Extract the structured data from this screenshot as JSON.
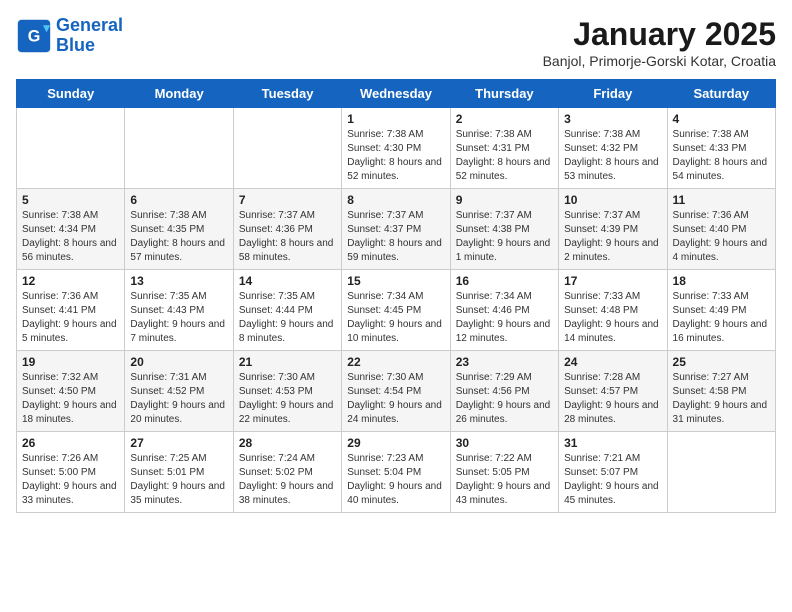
{
  "logo": {
    "line1": "General",
    "line2": "Blue"
  },
  "title": "January 2025",
  "location": "Banjol, Primorje-Gorski Kotar, Croatia",
  "days_of_week": [
    "Sunday",
    "Monday",
    "Tuesday",
    "Wednesday",
    "Thursday",
    "Friday",
    "Saturday"
  ],
  "weeks": [
    [
      {
        "day": "",
        "info": ""
      },
      {
        "day": "",
        "info": ""
      },
      {
        "day": "",
        "info": ""
      },
      {
        "day": "1",
        "info": "Sunrise: 7:38 AM\nSunset: 4:30 PM\nDaylight: 8 hours and 52 minutes."
      },
      {
        "day": "2",
        "info": "Sunrise: 7:38 AM\nSunset: 4:31 PM\nDaylight: 8 hours and 52 minutes."
      },
      {
        "day": "3",
        "info": "Sunrise: 7:38 AM\nSunset: 4:32 PM\nDaylight: 8 hours and 53 minutes."
      },
      {
        "day": "4",
        "info": "Sunrise: 7:38 AM\nSunset: 4:33 PM\nDaylight: 8 hours and 54 minutes."
      }
    ],
    [
      {
        "day": "5",
        "info": "Sunrise: 7:38 AM\nSunset: 4:34 PM\nDaylight: 8 hours and 56 minutes."
      },
      {
        "day": "6",
        "info": "Sunrise: 7:38 AM\nSunset: 4:35 PM\nDaylight: 8 hours and 57 minutes."
      },
      {
        "day": "7",
        "info": "Sunrise: 7:37 AM\nSunset: 4:36 PM\nDaylight: 8 hours and 58 minutes."
      },
      {
        "day": "8",
        "info": "Sunrise: 7:37 AM\nSunset: 4:37 PM\nDaylight: 8 hours and 59 minutes."
      },
      {
        "day": "9",
        "info": "Sunrise: 7:37 AM\nSunset: 4:38 PM\nDaylight: 9 hours and 1 minute."
      },
      {
        "day": "10",
        "info": "Sunrise: 7:37 AM\nSunset: 4:39 PM\nDaylight: 9 hours and 2 minutes."
      },
      {
        "day": "11",
        "info": "Sunrise: 7:36 AM\nSunset: 4:40 PM\nDaylight: 9 hours and 4 minutes."
      }
    ],
    [
      {
        "day": "12",
        "info": "Sunrise: 7:36 AM\nSunset: 4:41 PM\nDaylight: 9 hours and 5 minutes."
      },
      {
        "day": "13",
        "info": "Sunrise: 7:35 AM\nSunset: 4:43 PM\nDaylight: 9 hours and 7 minutes."
      },
      {
        "day": "14",
        "info": "Sunrise: 7:35 AM\nSunset: 4:44 PM\nDaylight: 9 hours and 8 minutes."
      },
      {
        "day": "15",
        "info": "Sunrise: 7:34 AM\nSunset: 4:45 PM\nDaylight: 9 hours and 10 minutes."
      },
      {
        "day": "16",
        "info": "Sunrise: 7:34 AM\nSunset: 4:46 PM\nDaylight: 9 hours and 12 minutes."
      },
      {
        "day": "17",
        "info": "Sunrise: 7:33 AM\nSunset: 4:48 PM\nDaylight: 9 hours and 14 minutes."
      },
      {
        "day": "18",
        "info": "Sunrise: 7:33 AM\nSunset: 4:49 PM\nDaylight: 9 hours and 16 minutes."
      }
    ],
    [
      {
        "day": "19",
        "info": "Sunrise: 7:32 AM\nSunset: 4:50 PM\nDaylight: 9 hours and 18 minutes."
      },
      {
        "day": "20",
        "info": "Sunrise: 7:31 AM\nSunset: 4:52 PM\nDaylight: 9 hours and 20 minutes."
      },
      {
        "day": "21",
        "info": "Sunrise: 7:30 AM\nSunset: 4:53 PM\nDaylight: 9 hours and 22 minutes."
      },
      {
        "day": "22",
        "info": "Sunrise: 7:30 AM\nSunset: 4:54 PM\nDaylight: 9 hours and 24 minutes."
      },
      {
        "day": "23",
        "info": "Sunrise: 7:29 AM\nSunset: 4:56 PM\nDaylight: 9 hours and 26 minutes."
      },
      {
        "day": "24",
        "info": "Sunrise: 7:28 AM\nSunset: 4:57 PM\nDaylight: 9 hours and 28 minutes."
      },
      {
        "day": "25",
        "info": "Sunrise: 7:27 AM\nSunset: 4:58 PM\nDaylight: 9 hours and 31 minutes."
      }
    ],
    [
      {
        "day": "26",
        "info": "Sunrise: 7:26 AM\nSunset: 5:00 PM\nDaylight: 9 hours and 33 minutes."
      },
      {
        "day": "27",
        "info": "Sunrise: 7:25 AM\nSunset: 5:01 PM\nDaylight: 9 hours and 35 minutes."
      },
      {
        "day": "28",
        "info": "Sunrise: 7:24 AM\nSunset: 5:02 PM\nDaylight: 9 hours and 38 minutes."
      },
      {
        "day": "29",
        "info": "Sunrise: 7:23 AM\nSunset: 5:04 PM\nDaylight: 9 hours and 40 minutes."
      },
      {
        "day": "30",
        "info": "Sunrise: 7:22 AM\nSunset: 5:05 PM\nDaylight: 9 hours and 43 minutes."
      },
      {
        "day": "31",
        "info": "Sunrise: 7:21 AM\nSunset: 5:07 PM\nDaylight: 9 hours and 45 minutes."
      },
      {
        "day": "",
        "info": ""
      }
    ]
  ]
}
